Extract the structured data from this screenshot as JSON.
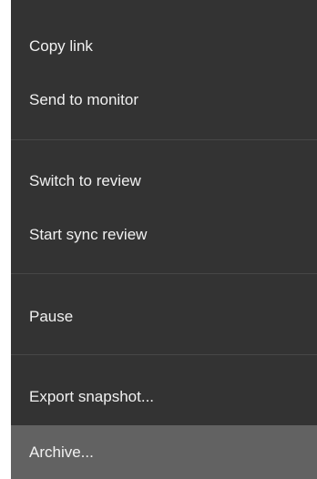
{
  "menu": {
    "items": [
      {
        "label": "Copy link"
      },
      {
        "label": "Send to monitor"
      },
      {
        "label": "Switch to review"
      },
      {
        "label": "Start sync review"
      },
      {
        "label": "Pause"
      },
      {
        "label": "Export snapshot..."
      },
      {
        "label": "Archive..."
      }
    ],
    "colors": {
      "background": "#333333",
      "highlight": "#626262",
      "text": "#f1f1f1",
      "divider": "#474747"
    }
  }
}
